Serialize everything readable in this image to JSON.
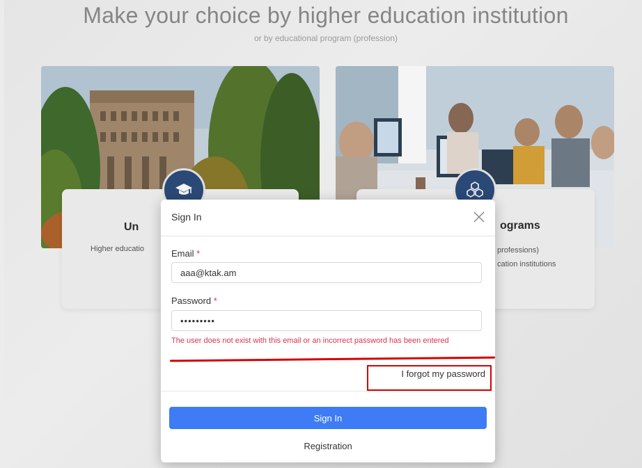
{
  "hero": {
    "title": "Make your choice by higher education institution",
    "subtitle": "or by educational program (profession)"
  },
  "cards": {
    "left": {
      "title_visible": "Un",
      "desc_visible": "Higher educatio",
      "icon": "graduation-cap-icon"
    },
    "right": {
      "title_visible": "ograms",
      "desc_line1_visible": "professions)",
      "desc_line2_visible": "cation institutions",
      "icon": "cubes-icon"
    }
  },
  "modal": {
    "title": "Sign In",
    "email_label": "Email",
    "password_label": "Password",
    "required_mark": "*",
    "email_value": "aaa@ktak.am",
    "password_value": "•••••••••",
    "error_message": "The user does not exist with this email or an incorrect password has been entered",
    "forgot_password": "I forgot my password",
    "signin_button": "Sign In",
    "registration": "Registration"
  },
  "colors": {
    "primary_button": "#3d7cf4",
    "error": "#e0314b",
    "annotation": "#d40000",
    "icon_badge": "#2b4a7a"
  }
}
